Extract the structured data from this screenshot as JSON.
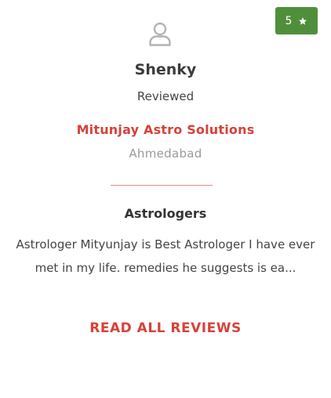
{
  "review": {
    "rating": "5",
    "reviewer_name": "Shenky",
    "reviewed_label": "Reviewed",
    "business_name": "Mitunjay Astro Solutions",
    "business_city": "Ahmedabad",
    "category": "Astrologers",
    "text": "Astrologer Mityunjay is Best Astrologer I have ever met in my life. remedies he suggests is ea...",
    "read_all_label": "READ ALL REVIEWS"
  },
  "icons": {
    "user": "user-icon",
    "star": "star-icon"
  },
  "colors": {
    "badge_bg": "#4f8f3b",
    "accent": "#d6423a",
    "divider": "#e08a8a"
  }
}
